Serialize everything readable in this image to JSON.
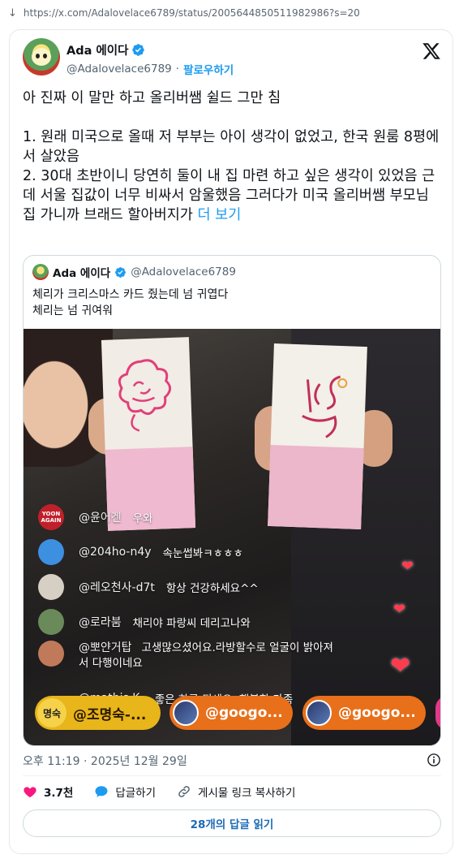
{
  "browser": {
    "url": "https://x.com/Adalovelace6789/status/2005644850511982986?s=20"
  },
  "tweet": {
    "display_name": "Ada 에이다",
    "handle": "@Adalovelace6789",
    "separator": "·",
    "follow_label": "팔로우하기",
    "text": "아 진짜 이 말만 하고 올리버쌤 쉴드 그만 침\n\n1. 원래 미국으로 올때 저 부부는 아이 생각이 없었고, 한국 원룸 8평에서 살았음\n2. 30대 초반이니 당연히 둘이 내 집 마련 하고 싶은 생각이 있었음 근데 서울 집값이 너무 비싸서 암울했음 그러다가 미국 올리버쌤 부모님 집 가니까 브래드 할아버지가 ",
    "more_label": "더 보기",
    "timestamp": "오후 11:19 · 2025년 12월 29일",
    "likes": "3.7천",
    "reply_label": "답글하기",
    "copy_link_label": "게시물 링크 복사하기",
    "read_replies_label": "28개의 답글 읽기"
  },
  "quote": {
    "display_name": "Ada 에이다",
    "handle": "@Adalovelace6789",
    "text": "체리가 크리스마스 카드 줬는데 넘 귀엽다\n체리는 넘 귀여워"
  },
  "video": {
    "comments": [
      {
        "user": "@윤어겐",
        "message": "우와"
      },
      {
        "user": "@204ho-n4y",
        "message": "속눈썹봐ㅋㅎㅎㅎ"
      },
      {
        "user": "@레오천사-d7t",
        "message": "항상 건강하세요^^"
      },
      {
        "user": "@로라붐",
        "message": "채리야 파랑씨 데리고나와"
      },
      {
        "user": "@뽀얀거탑",
        "message": "고생많으셨어요.라방할수로 얼굴이 밝아져",
        "message_line2": "서 다행이네요"
      },
      {
        "user": "@mathis.K.",
        "message": "좋은 하루 되세요. 행복한 가족"
      }
    ],
    "avatar_badge_text": "YOON AGAIN",
    "pills": [
      {
        "badge": "명숙",
        "label": "@조명숙-..."
      },
      {
        "label": "@googo..."
      },
      {
        "label": "@googo..."
      }
    ],
    "colors": {
      "pill_yellow": "#e8b51a",
      "pill_orange": "#e8701a",
      "pill_pink": "#e13a8a",
      "heart": "#ff3b4e",
      "card_pink": "#efb9cf"
    }
  },
  "colors": {
    "accent": "#1d9bf0",
    "text": "#0f1419",
    "muted": "#536471",
    "like": "#f91880"
  }
}
